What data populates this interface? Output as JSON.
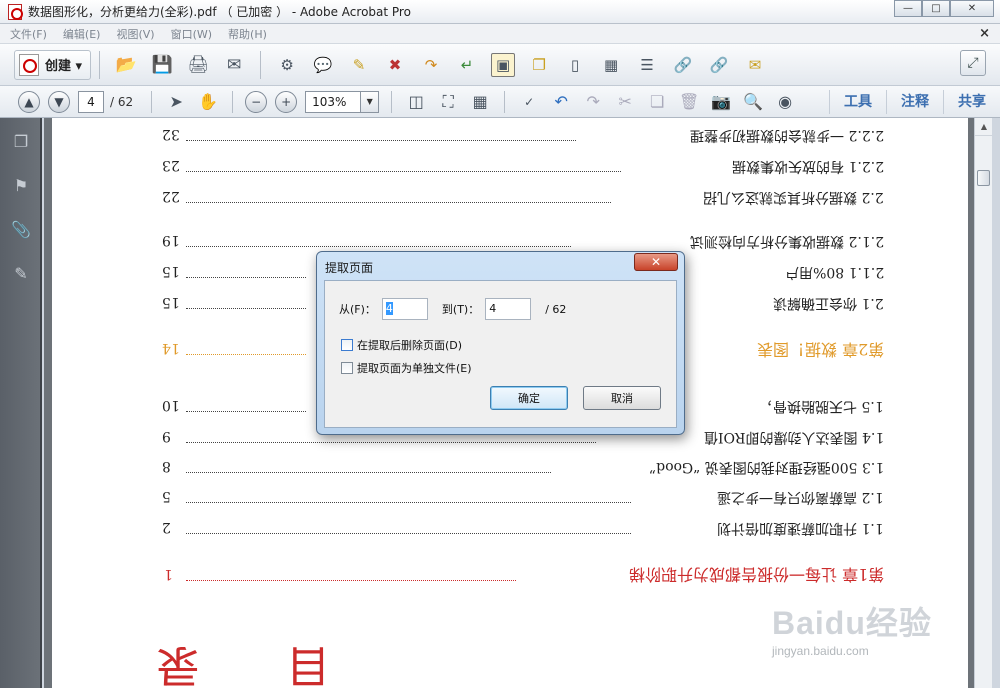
{
  "window": {
    "title": "数据图形化，分析更给力(全彩).pdf （ 已加密 ） - Adobe Acrobat Pro",
    "minimize": "—",
    "restore": "□",
    "close": "✕"
  },
  "menu": {
    "items": [
      "文件(F)",
      "编辑(E)",
      "视图(V)",
      "窗口(W)",
      "帮助(H)"
    ],
    "close": "×"
  },
  "toolbar": {
    "create_label": "创建 ▾"
  },
  "nav": {
    "current_page": "4",
    "total_pages": "/ 62",
    "zoom": "103%"
  },
  "right_tabs": {
    "tools": "工具",
    "comment": "注释",
    "share": "共享"
  },
  "document": {
    "toc": [
      {
        "text": "2.2.2 一步就会的数据初步整理",
        "page": "32",
        "style": "normal"
      },
      {
        "text": "2.2.1 有的放矢收集数据",
        "page": "23",
        "style": "normal"
      },
      {
        "text": "2.2 数据分析其实就这么几招",
        "page": "22",
        "style": "normal"
      },
      {
        "text": "2.1.2 数据收集分析方向检测试",
        "page": "19",
        "style": "normal"
      },
      {
        "text": "2.1.1 80%用户",
        "page": "15",
        "style": "normal"
      },
      {
        "text": "2.1 你会正确解读",
        "page": "15",
        "style": "normal"
      },
      {
        "text": "第2章 数据！图表",
        "page": "14",
        "style": "orange"
      },
      {
        "text": "1.5 七天脱胎换骨，",
        "page": "10",
        "style": "normal"
      },
      {
        "text": "1.4 图表达人劲爆的即ROI值",
        "page": "9",
        "style": "normal"
      },
      {
        "text": "1.3 500强经理对我的图表说 “Good”",
        "page": "8",
        "style": "normal"
      },
      {
        "text": "1.2 高薪离你只有一步之遥",
        "page": "5",
        "style": "normal"
      },
      {
        "text": "1.1 升职加薪速度加倍计划",
        "page": "2",
        "style": "normal"
      },
      {
        "text": "第1章 让每一份报告都成为升职阶梯",
        "page": "1",
        "style": "red"
      }
    ],
    "heading_left": "录",
    "heading_right": "目"
  },
  "dialog": {
    "title": "提取页面",
    "from_label": "从(F)：",
    "from_value": "4",
    "to_label": "到(T)：",
    "to_value": "4",
    "total": "/ 62",
    "delete_after": "在提取后删除页面(D)",
    "separate_files": "提取页面为单独文件(E)",
    "ok": "确定",
    "cancel": "取消",
    "close": "✕"
  },
  "watermark": {
    "text": "Baidu经验",
    "url": "jingyan.baidu.com"
  },
  "colors": {
    "accent_red": "#cc2b2b",
    "accent_orange": "#e09a2a",
    "tab_blue": "#3c6fb0"
  },
  "icons": [
    "pdf-icon",
    "open-folder-icon",
    "save-icon",
    "print-icon",
    "email-icon",
    "gear-icon",
    "comment-icon",
    "highlight-icon",
    "crop-icon",
    "export-icon",
    "insert-icon",
    "select-icon",
    "copy-icon",
    "page-icon",
    "combine-icon",
    "form-icon",
    "link-icon",
    "unlink-icon",
    "stamp-icon",
    "expand-icon",
    "prev-page-icon",
    "next-page-icon",
    "select-tool-icon",
    "hand-tool-icon",
    "zoom-out-icon",
    "zoom-in-icon",
    "fit-page-icon",
    "fullscreen-icon",
    "two-page-icon",
    "spellcheck-icon",
    "undo-icon",
    "redo-icon",
    "cut-icon",
    "paste-icon",
    "delete-icon",
    "snapshot-icon",
    "search-icon",
    "binoculars-icon",
    "pages-panel-icon",
    "bookmark-icon",
    "attachment-icon",
    "signature-icon"
  ]
}
